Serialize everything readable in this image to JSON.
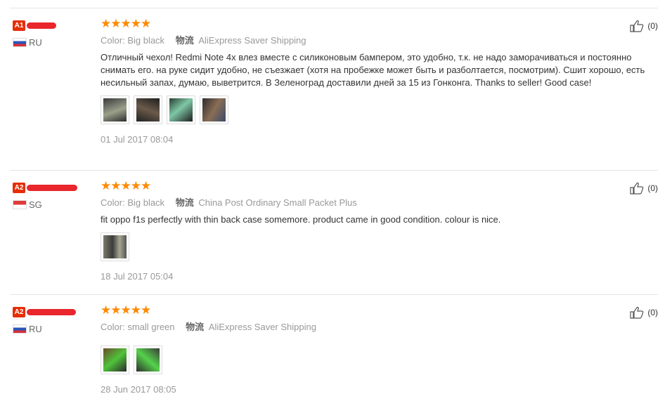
{
  "reviews": [
    {
      "level": "A1",
      "country": "RU",
      "stars": "★★★★★",
      "color_label": "Color:",
      "color_value": "Big black",
      "ship_icon": "物流",
      "shipping": "AliExpress Saver Shipping",
      "text": "Отличный чехол! Redmi Note 4x влез вместе с силиконовым бампером, это удобно, т.к. не надо заморачиваться и постоянно снимать его. на руке сидит удобно, не съезжает (хотя на пробежке может быть и разболтается, посмотрим). Сшит хорошо, есть несильный запах, думаю, выветрится. В Зеленоград доставили дней за 15 из Гонконга. Thanks to seller! Good case!",
      "date": "01 Jul 2017 08:04",
      "likes": "(0)"
    },
    {
      "level": "A2",
      "country": "SG",
      "stars": "★★★★★",
      "color_label": "Color:",
      "color_value": "Big black",
      "ship_icon": "物流",
      "shipping": "China Post Ordinary Small Packet Plus",
      "text": "fit oppo f1s perfectly with thin back case somemore. product came in good condition. colour is nice.",
      "date": "18 Jul 2017 05:04",
      "likes": "(0)"
    },
    {
      "level": "A2",
      "country": "RU",
      "stars": "★★★★★",
      "color_label": "Color:",
      "color_value": "small green",
      "ship_icon": "物流",
      "shipping": "AliExpress Saver Shipping",
      "text": "",
      "date": "28 Jun 2017 08:05",
      "likes": "(0)"
    }
  ],
  "icons": {
    "like": "thumbs-up-icon",
    "star": "star-icon"
  },
  "colors": {
    "star": "#ff8a00",
    "level_badge": "#e62e04",
    "redaction": "#e8262b"
  }
}
